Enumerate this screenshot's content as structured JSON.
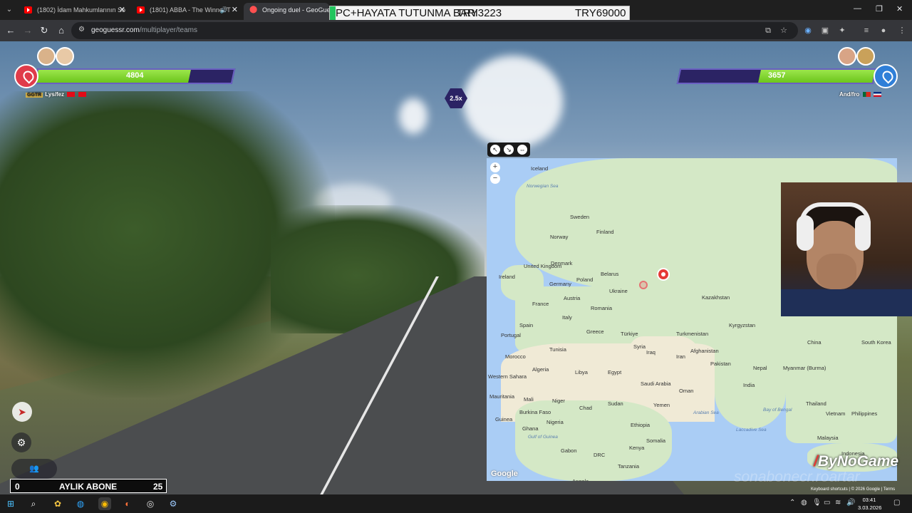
{
  "browser": {
    "tabs": [
      {
        "title": "(1802) İdam Mahkumlarının So",
        "type": "youtube",
        "active": false,
        "audio": false
      },
      {
        "title": "(1801) ABBA - The Winner T",
        "type": "youtube",
        "active": false,
        "audio": true
      },
      {
        "title": "Ongoing duel - GeoGuessr",
        "type": "geoguessr",
        "active": true,
        "audio": false
      }
    ],
    "url_host": "geoguessr.com",
    "url_path": "/multiplayer/teams"
  },
  "banner": {
    "left_text": "PC+HAYATA TUTUNMA BARI",
    "mid_text": "TRY3223",
    "right_text": "TRY69000"
  },
  "game": {
    "left_team": {
      "health": 4804,
      "health_fraction": 0.78,
      "color": "#e03b4a",
      "tag": "GGTR",
      "name": "Lys/fez"
    },
    "right_team": {
      "health": 3657,
      "health_fraction": 0.59,
      "color": "#2f7fd8",
      "name": "And/fro"
    },
    "multiplier": "2.5x"
  },
  "map": {
    "labels": [
      {
        "text": "Norwegian Sea",
        "kind": "sea"
      },
      {
        "text": "Sweden",
        "kind": "land"
      },
      {
        "text": "Finland",
        "kind": "land"
      },
      {
        "text": "Norway",
        "kind": "land"
      },
      {
        "text": "United Kingdom",
        "kind": "land"
      },
      {
        "text": "Ireland",
        "kind": "land"
      },
      {
        "text": "Denmark",
        "kind": "land"
      },
      {
        "text": "Belarus",
        "kind": "land"
      },
      {
        "text": "Poland",
        "kind": "land"
      },
      {
        "text": "Germany",
        "kind": "land"
      },
      {
        "text": "Ukraine",
        "kind": "land"
      },
      {
        "text": "Kazakhstan",
        "kind": "land"
      },
      {
        "text": "Austria",
        "kind": "land"
      },
      {
        "text": "France",
        "kind": "land"
      },
      {
        "text": "Romania",
        "kind": "land"
      },
      {
        "text": "Italy",
        "kind": "land"
      },
      {
        "text": "Spain",
        "kind": "land"
      },
      {
        "text": "Portugal",
        "kind": "land"
      },
      {
        "text": "Greece",
        "kind": "land"
      },
      {
        "text": "Türkiye",
        "kind": "land"
      },
      {
        "text": "Turkmenistan",
        "kind": "land"
      },
      {
        "text": "Kyrgyzstan",
        "kind": "land"
      },
      {
        "text": "China",
        "kind": "land"
      },
      {
        "text": "South Korea",
        "kind": "land"
      },
      {
        "text": "Tunisia",
        "kind": "land"
      },
      {
        "text": "Morocco",
        "kind": "land"
      },
      {
        "text": "Syria",
        "kind": "land"
      },
      {
        "text": "Iraq",
        "kind": "land"
      },
      {
        "text": "Iran",
        "kind": "land"
      },
      {
        "text": "Afghanistan",
        "kind": "land"
      },
      {
        "text": "Pakistan",
        "kind": "land"
      },
      {
        "text": "Nepal",
        "kind": "land"
      },
      {
        "text": "Algeria",
        "kind": "land"
      },
      {
        "text": "Libya",
        "kind": "land"
      },
      {
        "text": "Egypt",
        "kind": "land"
      },
      {
        "text": "Western Sahara",
        "kind": "land"
      },
      {
        "text": "Saudi Arabia",
        "kind": "land"
      },
      {
        "text": "Oman",
        "kind": "land"
      },
      {
        "text": "India",
        "kind": "land"
      },
      {
        "text": "Myanmar (Burma)",
        "kind": "land"
      },
      {
        "text": "Mauritania",
        "kind": "land"
      },
      {
        "text": "Mali",
        "kind": "land"
      },
      {
        "text": "Niger",
        "kind": "land"
      },
      {
        "text": "Chad",
        "kind": "land"
      },
      {
        "text": "Sudan",
        "kind": "land"
      },
      {
        "text": "Yemen",
        "kind": "land"
      },
      {
        "text": "Thailand",
        "kind": "land"
      },
      {
        "text": "Vietnam",
        "kind": "land"
      },
      {
        "text": "Philippines",
        "kind": "land"
      },
      {
        "text": "Burkina Faso",
        "kind": "land"
      },
      {
        "text": "Guinea",
        "kind": "land"
      },
      {
        "text": "Nigeria",
        "kind": "land"
      },
      {
        "text": "Ghana",
        "kind": "land"
      },
      {
        "text": "Ethiopia",
        "kind": "land"
      },
      {
        "text": "Somalia",
        "kind": "land"
      },
      {
        "text": "Arabian Sea",
        "kind": "sea"
      },
      {
        "text": "Bay of Bengal",
        "kind": "sea"
      },
      {
        "text": "Malaysia",
        "kind": "land"
      },
      {
        "text": "Gulf of Guinea",
        "kind": "sea"
      },
      {
        "text": "Laccadive Sea",
        "kind": "sea"
      },
      {
        "text": "Gabon",
        "kind": "land"
      },
      {
        "text": "DRC",
        "kind": "land"
      },
      {
        "text": "Kenya",
        "kind": "land"
      },
      {
        "text": "Tanzania",
        "kind": "land"
      },
      {
        "text": "Indonesia",
        "kind": "land"
      },
      {
        "text": "Angola",
        "kind": "land"
      },
      {
        "text": "Iceland",
        "kind": "land"
      }
    ],
    "attribution": "Keyboard shortcuts | © 2026 Google | Terms",
    "google": "Google"
  },
  "overlay": {
    "sub_left": "0",
    "sub_label": "AYLIK ABONE",
    "sub_right": "25",
    "watermark": "sonabonecr.roartar",
    "brand": "ByNoGame"
  },
  "taskbar": {
    "time": "03:41",
    "date": "3.03.2026"
  }
}
